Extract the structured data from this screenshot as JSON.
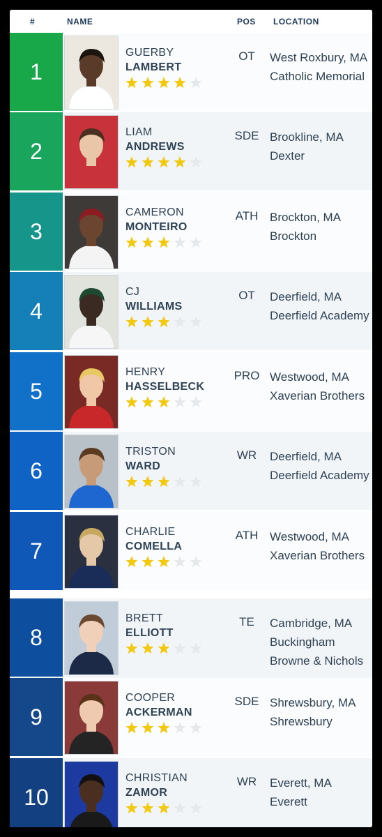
{
  "header": {
    "rank_label": "#",
    "name_label": "NAME",
    "pos_label": "POS",
    "location_label": "LOCATION"
  },
  "colors": {
    "star_filled": "#f2c811",
    "star_empty": "#e6e9ec"
  },
  "players": [
    {
      "rank": "1",
      "first": "GUERBY",
      "last": "LAMBERT",
      "stars": 4,
      "pos": "OT",
      "city": "West Roxbury, MA",
      "school": "Catholic Memorial",
      "school2": "",
      "rank_color": "#18a84a",
      "photo_bg": "#ece8e0",
      "skin": "#5a3a28",
      "hair": "#1b140f",
      "jersey": "#ffffff"
    },
    {
      "rank": "2",
      "first": "LIAM",
      "last": "ANDREWS",
      "stars": 4,
      "pos": "SDE",
      "city": "Brookline, MA",
      "school": "Dexter",
      "school2": "",
      "rank_color": "#1aa55c",
      "photo_bg": "#c8323a",
      "skin": "#e9c6a8",
      "hair": "#4a3020",
      "jersey": "#c8323a"
    },
    {
      "rank": "3",
      "first": "CAMERON",
      "last": "MONTEIRO",
      "stars": 3,
      "pos": "ATH",
      "city": "Brockton, MA",
      "school": "Brockton",
      "school2": "",
      "rank_color": "#16958a",
      "photo_bg": "#3e3a38",
      "skin": "#6b4530",
      "hair": "#8c1c22",
      "jersey": "#f4f4f4"
    },
    {
      "rank": "4",
      "first": "CJ",
      "last": "WILLIAMS",
      "stars": 3,
      "pos": "OT",
      "city": "Deerfield, MA",
      "school": "Deerfield Academy",
      "school2": "",
      "rank_color": "#1580b8",
      "photo_bg": "#dfe3dc",
      "skin": "#3a2a22",
      "hair": "#1d4a30",
      "jersey": "#f6f6f6"
    },
    {
      "rank": "5",
      "first": "HENRY",
      "last": "HASSELBECK",
      "stars": 3,
      "pos": "PRO",
      "city": "Westwood, MA",
      "school": "Xaverian Brothers",
      "school2": "",
      "rank_color": "#1170c8",
      "photo_bg": "#7a2a24",
      "skin": "#f0c8a8",
      "hair": "#e8c860",
      "jersey": "#c8282a"
    },
    {
      "rank": "6",
      "first": "TRISTON",
      "last": "WARD",
      "stars": 3,
      "pos": "WR",
      "city": "Deerfield, MA",
      "school": "Deerfield Academy",
      "school2": "",
      "rank_color": "#0f63c4",
      "photo_bg": "#b8c0c8",
      "skin": "#c79a78",
      "hair": "#5a3a20",
      "jersey": "#1e66d0"
    },
    {
      "rank": "7",
      "first": "CHARLIE",
      "last": "COMELLA",
      "stars": 3,
      "pos": "ATH",
      "city": "Westwood, MA",
      "school": "Xaverian Brothers",
      "school2": "",
      "rank_color": "#1058b8",
      "photo_bg": "#2a3040",
      "skin": "#e4c8a8",
      "hair": "#c8a860",
      "jersey": "#1a2c58"
    },
    {
      "rank": "8",
      "first": "BRETT",
      "last": "ELLIOTT",
      "stars": 3,
      "pos": "TE",
      "city": "Cambridge, MA",
      "school": "Buckingham",
      "school2": "Browne & Nichols",
      "rank_color": "#0e4e9e",
      "photo_bg": "#c0ccd8",
      "skin": "#f0d0b8",
      "hair": "#6a4a30",
      "jersey": "#1c2a48"
    },
    {
      "rank": "9",
      "first": "COOPER",
      "last": "ACKERMAN",
      "stars": 3,
      "pos": "SDE",
      "city": "Shrewsbury, MA",
      "school": "Shrewsbury",
      "school2": "",
      "rank_color": "#14488a",
      "photo_bg": "#8a3a38",
      "skin": "#f0cab0",
      "hair": "#5a3218",
      "jersey": "#242424"
    },
    {
      "rank": "10",
      "first": "CHRISTIAN",
      "last": "ZAMOR",
      "stars": 3,
      "pos": "WR",
      "city": "Everett, MA",
      "school": "Everett",
      "school2": "",
      "rank_color": "#124080",
      "photo_bg": "#1c3aa0",
      "skin": "#4a2e20",
      "hair": "#121010",
      "jersey": "#1a1a1a"
    }
  ]
}
